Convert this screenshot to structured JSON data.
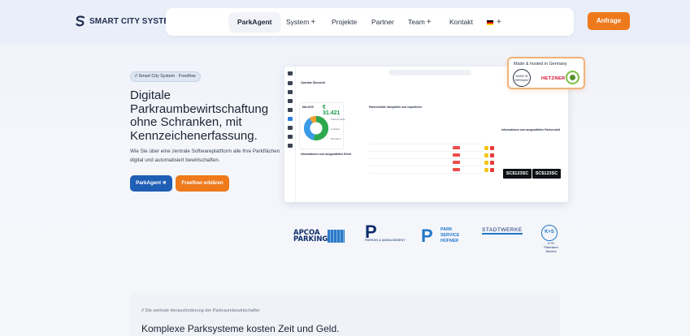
{
  "brand": {
    "name": "SMART CITY SYSTEM"
  },
  "nav": {
    "items": [
      {
        "label": "ParkAgent",
        "active": true
      },
      {
        "label": "System",
        "has_submenu": true
      },
      {
        "label": "Projekte"
      },
      {
        "label": "Partner"
      },
      {
        "label": "Team",
        "has_submenu": true
      },
      {
        "label": "Kontakt"
      }
    ],
    "language_icon": "flag-de-icon",
    "cta": "Anfrage"
  },
  "hero": {
    "badge": "// Smart City System · Freeflow",
    "headline_1": "Digitale",
    "headline_2": "Parkraumbewirtschaftung",
    "headline_3": "ohne Schranken, mit",
    "headline_4": "Kennzeichenerfassung.",
    "subtext": "Wie Sie über eine zentrale Softwareplattform alle Ihre Parkflächen digital und automatisiert bewirtschaften.",
    "btn_primary": "ParkAgent",
    "btn_secondary": "Freeflow erklären"
  },
  "dashboard": {
    "month": "Mai 2025",
    "revenue": "€ 31.421",
    "list_title": "Parkverstöße überprüfen und exportieren",
    "detail_title": "Informationen zum ausgewählten Parkverstoß",
    "event_title": "Informationen zum ausgewählten Event",
    "plate_1": "SC$123SC",
    "plate_2": "SC$123SC",
    "legend": [
      "Parkverstöße",
      "Ausfahrt",
      "Bezahlen"
    ]
  },
  "made_badge": {
    "title": "Made & hosted in Germany",
    "seal": "MADE IN GERMANY",
    "host": "HETZNER"
  },
  "partners": [
    {
      "name": "APCOA PARKING"
    },
    {
      "name": "PARKEN & MANAGEMENT"
    },
    {
      "name": "PARK SERVICE HÜFNER"
    },
    {
      "name": "STADTWERKE"
    },
    {
      "name": "K+S Parkraum Service"
    }
  ],
  "section": {
    "eyebrow": "// Die zentrale Herausforderung der Parkraumbewirtschafter",
    "title": "Komplexe Parksysteme kosten Zeit und Geld."
  },
  "colors": {
    "accent": "#ee7a1c",
    "primary": "#1f5eb5",
    "text": "#1c2434"
  }
}
